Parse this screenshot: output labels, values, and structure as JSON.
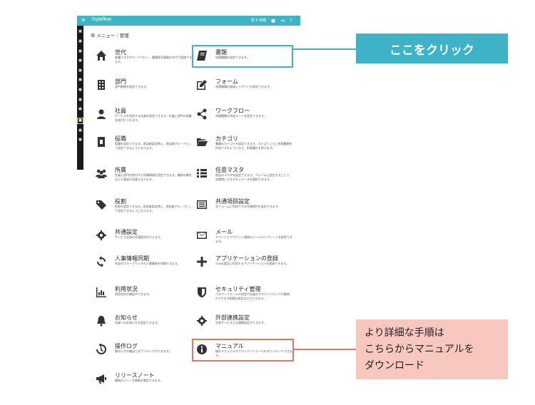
{
  "app": {
    "title": "Styleflow",
    "user": "松下 和樹"
  },
  "breadcrumb": "メニュー｜管理",
  "left_items": [
    {
      "name": "世代",
      "desc": "各種マスタやワークフロー、書類等の情報を世代で管理できます。",
      "icon": "home-icon"
    },
    {
      "name": "部門",
      "desc": "部門情報を設定できます。",
      "icon": "building-icon"
    },
    {
      "name": "社員",
      "desc": "サービスを利用する社員を設定できます。社員に部門の役職を紐付けられます。",
      "icon": "user-icon"
    },
    {
      "name": "役職",
      "desc": "役職を設定できます。承認者設定時に、承認者グループとして設定できるようになります。",
      "icon": "badge-icon"
    },
    {
      "name": "所属",
      "desc": "社員と部門を紐付けた所属情報を設定できます。兼務の場合なども登録が必要となります。",
      "icon": "group-icon"
    },
    {
      "name": "役割",
      "desc": "役割を設定できます。承認者設定時に、承認者グループとして設定できるようになります。",
      "icon": "tag-icon"
    },
    {
      "name": "共通設定",
      "desc": "サービス全体の共通設定を行えます。",
      "icon": "gear-icon"
    },
    {
      "name": "人事情報同期",
      "desc": "外部のグループウェアの人事情報を同期できます。",
      "icon": "sync-icon"
    },
    {
      "name": "利用状況",
      "desc": "利用状況の確認ができます。",
      "icon": "bar-chart-icon"
    },
    {
      "name": "お知らせ",
      "desc": "社員へのお知らせを設定できます。",
      "icon": "bell-icon"
    },
    {
      "name": "操作ログ",
      "desc": "操作ログの確認とダウンロードができます。",
      "icon": "history-icon"
    },
    {
      "name": "リリースノート",
      "desc": "最新のリリース情報を確認できます。",
      "icon": "megaphone-icon"
    }
  ],
  "right_items": [
    {
      "name": "書類",
      "desc": "申請書類を設定できます。",
      "icon": "book-icon"
    },
    {
      "name": "フォーム",
      "desc": "申請書類の画面レイアウトを設定できます。",
      "icon": "edit-icon"
    },
    {
      "name": "ワークフロー",
      "desc": "申請書類の承認ルートを設定できます。",
      "icon": "share-icon"
    },
    {
      "name": "カテゴリ",
      "desc": "書類のカテゴリを設定できます。カテゴリごとに申請書類を作成できるようになり、申請漏れを防げます。",
      "icon": "folder-icon"
    },
    {
      "name": "任意マスタ",
      "desc": "独自のマスタを設定できます。フォームに設定することで、申請時にマスタからデータを選択できます。",
      "icon": "list-icon"
    },
    {
      "name": "共通項目設定",
      "desc": "全フォームに利用できる共通項目を設定できます。",
      "icon": "form-list-icon"
    },
    {
      "name": "メール",
      "desc": "アラートとアカウント通知のメールテンプレートを設定できます。",
      "icon": "mail-icon"
    },
    {
      "name": "アプリケーションの登録",
      "desc": "OAuth認証に利用するアプリケーションを登録できます。",
      "icon": "plus-icon"
    },
    {
      "name": "セキュリティ管理",
      "desc": "パスワードルールの設定や社員のアカウントロックの解除、IPアクセス制限の設定などができます。",
      "icon": "shield-icon"
    },
    {
      "name": "外部連携設定",
      "desc": "外部サービスとの連携設定ができます。",
      "icon": "gear-icon"
    },
    {
      "name": "マニュアル",
      "desc": "操作マニュアルやクライアントツールをダウンロードできます。",
      "icon": "info-icon"
    }
  ],
  "callouts": {
    "click_here": "ここをクリック",
    "manual": [
      "より詳細な手順は",
      "こちらからマニュアルを",
      "ダウンロード"
    ]
  },
  "colors": {
    "accent": "#3cb3c6",
    "highlight_orange": "#e8735c",
    "callout_orange_bg": "#f8c7be",
    "sidebar": "#17191c",
    "sidebar_highlight": "#e6e000"
  }
}
